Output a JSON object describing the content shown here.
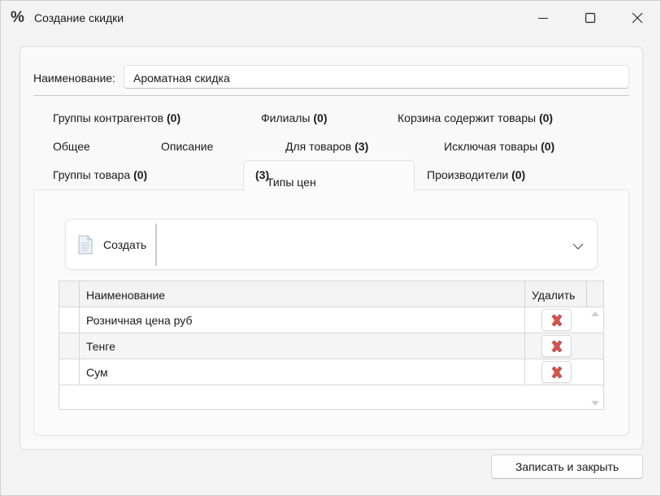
{
  "window": {
    "title": "Создание скидки",
    "icon": "percent-icon"
  },
  "form": {
    "name_label": "Наименование:",
    "name_value": "Ароматная скидка"
  },
  "tabs": {
    "row1": [
      {
        "label": "Группы контрагентов",
        "count": "(0)"
      },
      {
        "label": "Филиалы",
        "count": "(0)"
      },
      {
        "label": "Корзина содержит товары",
        "count": "(0)"
      }
    ],
    "row2": [
      {
        "label": "Общее",
        "count": ""
      },
      {
        "label": "Описание",
        "count": ""
      },
      {
        "label": "Для товаров",
        "count": "(3)"
      },
      {
        "label": "Исключая товары",
        "count": "(0)"
      }
    ],
    "row3": [
      {
        "label": "Группы товара",
        "count": "(0)"
      },
      {
        "label": "Типы цен",
        "count": "(3)",
        "active": true
      },
      {
        "label": "Производители",
        "count": "(0)"
      }
    ]
  },
  "toolbar": {
    "create_label": "Создать"
  },
  "grid": {
    "columns": [
      "Наименование",
      "Удалить"
    ],
    "rows": [
      {
        "name": "Розничная цена руб"
      },
      {
        "name": "Тенге"
      },
      {
        "name": "Сум"
      }
    ]
  },
  "footer": {
    "save_label": "Записать и закрыть"
  },
  "colors": {
    "delete_icon": "#d9534f",
    "background": "#f3f3f3"
  }
}
